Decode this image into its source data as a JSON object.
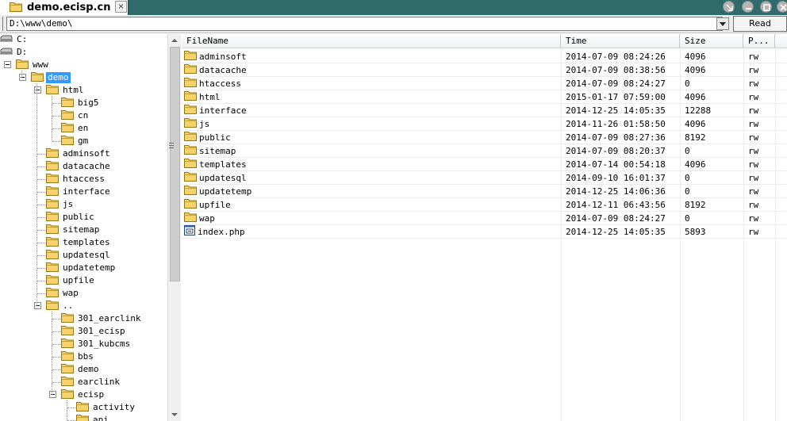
{
  "title_bar": {
    "tab_title": "demo.ecisp.cn",
    "close_label": "×"
  },
  "address_bar": {
    "path": "D:\\www\\demo\\",
    "read_label": "Read"
  },
  "tree": {
    "items": [
      {
        "label": "C:",
        "icon": "drive-icon",
        "level": 0,
        "expanded": false,
        "selected": false
      },
      {
        "label": "D:",
        "icon": "drive-icon",
        "level": 0,
        "expanded": false,
        "selected": false
      },
      {
        "label": "www",
        "icon": "folder-icon",
        "level": 1,
        "expanded": true,
        "selected": false
      },
      {
        "label": "demo",
        "icon": "folder-icon",
        "level": 2,
        "expanded": true,
        "selected": true
      },
      {
        "label": "html",
        "icon": "folder-icon",
        "level": 3,
        "expanded": true,
        "selected": false
      },
      {
        "label": "big5",
        "icon": "folder-icon",
        "level": 4,
        "expanded": false,
        "selected": false
      },
      {
        "label": "cn",
        "icon": "folder-icon",
        "level": 4,
        "expanded": false,
        "selected": false
      },
      {
        "label": "en",
        "icon": "folder-icon",
        "level": 4,
        "expanded": false,
        "selected": false
      },
      {
        "label": "gm",
        "icon": "folder-icon",
        "level": 4,
        "expanded": false,
        "selected": false
      },
      {
        "label": "adminsoft",
        "icon": "folder-icon",
        "level": 3,
        "expanded": false,
        "selected": false
      },
      {
        "label": "datacache",
        "icon": "folder-icon",
        "level": 3,
        "expanded": false,
        "selected": false
      },
      {
        "label": "htaccess",
        "icon": "folder-icon",
        "level": 3,
        "expanded": false,
        "selected": false
      },
      {
        "label": "interface",
        "icon": "folder-icon",
        "level": 3,
        "expanded": false,
        "selected": false
      },
      {
        "label": "js",
        "icon": "folder-icon",
        "level": 3,
        "expanded": false,
        "selected": false
      },
      {
        "label": "public",
        "icon": "folder-icon",
        "level": 3,
        "expanded": false,
        "selected": false
      },
      {
        "label": "sitemap",
        "icon": "folder-icon",
        "level": 3,
        "expanded": false,
        "selected": false
      },
      {
        "label": "templates",
        "icon": "folder-icon",
        "level": 3,
        "expanded": false,
        "selected": false
      },
      {
        "label": "updatesql",
        "icon": "folder-icon",
        "level": 3,
        "expanded": false,
        "selected": false
      },
      {
        "label": "updatetemp",
        "icon": "folder-icon",
        "level": 3,
        "expanded": false,
        "selected": false
      },
      {
        "label": "upfile",
        "icon": "folder-icon",
        "level": 3,
        "expanded": false,
        "selected": false
      },
      {
        "label": "wap",
        "icon": "folder-icon",
        "level": 3,
        "expanded": false,
        "selected": false
      },
      {
        "label": "..",
        "icon": "folder-icon",
        "level": 3,
        "expanded": true,
        "selected": false
      },
      {
        "label": "301_earclink",
        "icon": "folder-icon",
        "level": 4,
        "expanded": false,
        "selected": false
      },
      {
        "label": "301_ecisp",
        "icon": "folder-icon",
        "level": 4,
        "expanded": false,
        "selected": false
      },
      {
        "label": "301_kubcms",
        "icon": "folder-icon",
        "level": 4,
        "expanded": false,
        "selected": false
      },
      {
        "label": "bbs",
        "icon": "folder-icon",
        "level": 4,
        "expanded": false,
        "selected": false
      },
      {
        "label": "demo",
        "icon": "folder-icon",
        "level": 4,
        "expanded": false,
        "selected": false
      },
      {
        "label": "earclink",
        "icon": "folder-icon",
        "level": 4,
        "expanded": false,
        "selected": false
      },
      {
        "label": "ecisp",
        "icon": "folder-icon",
        "level": 4,
        "expanded": true,
        "selected": false
      },
      {
        "label": "activity",
        "icon": "folder-icon",
        "level": 5,
        "expanded": false,
        "selected": false
      },
      {
        "label": "api",
        "icon": "folder-icon",
        "level": 5,
        "expanded": false,
        "selected": false
      }
    ]
  },
  "file_list": {
    "columns": [
      "FileName",
      "Time",
      "Size",
      "P..."
    ],
    "rows": [
      {
        "name": "adminsoft",
        "icon": "folder-icon",
        "time": "2014-07-09 08:24:26",
        "size": "4096",
        "perm": "rw"
      },
      {
        "name": "datacache",
        "icon": "folder-icon",
        "time": "2014-07-09 08:38:56",
        "size": "4096",
        "perm": "rw"
      },
      {
        "name": "htaccess",
        "icon": "folder-icon",
        "time": "2014-07-09 08:24:27",
        "size": "0",
        "perm": "rw"
      },
      {
        "name": "html",
        "icon": "folder-icon",
        "time": "2015-01-17 07:59:00",
        "size": "4096",
        "perm": "rw"
      },
      {
        "name": "interface",
        "icon": "folder-icon",
        "time": "2014-12-25 14:05:35",
        "size": "12288",
        "perm": "rw"
      },
      {
        "name": "js",
        "icon": "folder-icon",
        "time": "2014-11-26 01:58:50",
        "size": "4096",
        "perm": "rw"
      },
      {
        "name": "public",
        "icon": "folder-icon",
        "time": "2014-07-09 08:27:36",
        "size": "8192",
        "perm": "rw"
      },
      {
        "name": "sitemap",
        "icon": "folder-icon",
        "time": "2014-07-09 08:20:37",
        "size": "0",
        "perm": "rw"
      },
      {
        "name": "templates",
        "icon": "folder-icon",
        "time": "2014-07-14 00:54:18",
        "size": "4096",
        "perm": "rw"
      },
      {
        "name": "updatesql",
        "icon": "folder-icon",
        "time": "2014-09-10 16:01:37",
        "size": "0",
        "perm": "rw"
      },
      {
        "name": "updatetemp",
        "icon": "folder-icon",
        "time": "2014-12-25 14:06:36",
        "size": "0",
        "perm": "rw"
      },
      {
        "name": "upfile",
        "icon": "folder-icon",
        "time": "2014-12-11 06:43:56",
        "size": "8192",
        "perm": "rw"
      },
      {
        "name": "wap",
        "icon": "folder-icon",
        "time": "2014-07-09 08:24:27",
        "size": "0",
        "perm": "rw"
      },
      {
        "name": "index.php",
        "icon": "php-file-icon",
        "time": "2014-12-25 14:05:35",
        "size": "5893",
        "perm": "rw"
      }
    ]
  },
  "colors": {
    "title_bar": "#2e6b6a",
    "selection": "#3399ff",
    "folder": "#f5d36b"
  }
}
